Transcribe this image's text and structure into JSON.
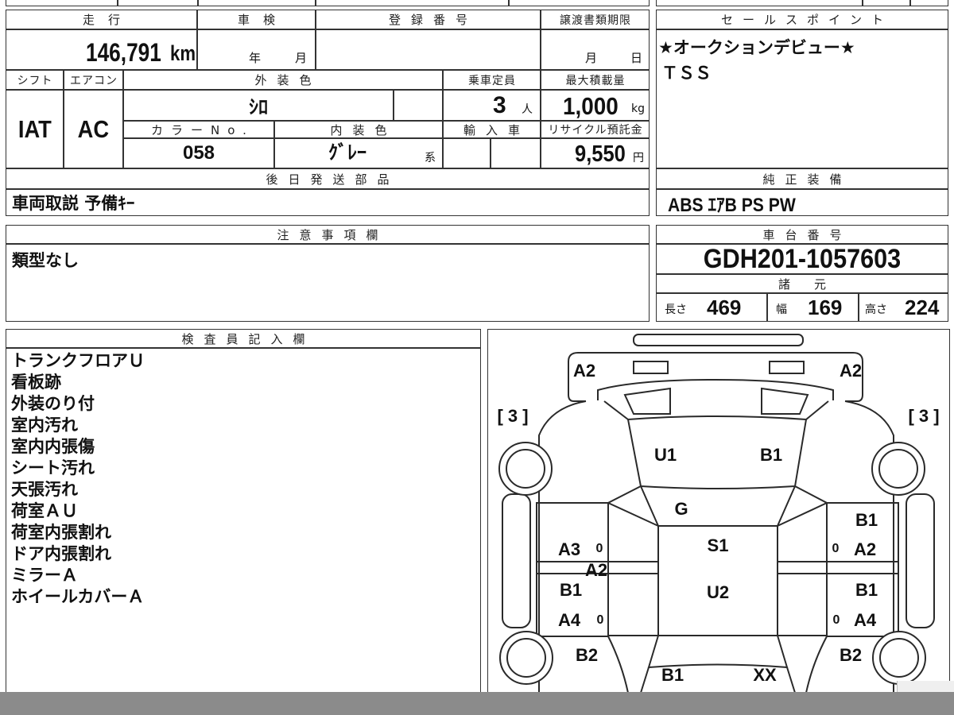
{
  "sheet": {
    "mileage": {
      "label": "走行",
      "value": "146,791",
      "unit": "km"
    },
    "inspection": {
      "label": "車検",
      "year_unit": "年",
      "month_unit": "月"
    },
    "registration": {
      "label": "登録番号"
    },
    "transfer_deadline": {
      "label": "譲渡書類期限",
      "month_unit": "月",
      "day_unit": "日"
    },
    "shift": {
      "label": "シフト",
      "value": "IAT"
    },
    "aircon": {
      "label": "エアコン",
      "value": "AC"
    },
    "exterior_color": {
      "label": "外装色",
      "value": "ｼﾛ"
    },
    "seating": {
      "label": "乗車定員",
      "value": "3",
      "unit": "人"
    },
    "max_load": {
      "label": "最大積載量",
      "value": "1,000",
      "unit": "kg"
    },
    "color_no": {
      "label": "カラーNo.",
      "value": "058"
    },
    "interior_color": {
      "label": "内装色",
      "value": "ｸﾞﾚｰ",
      "suffix": "系"
    },
    "import": {
      "label": "輸入車"
    },
    "recycle_fee": {
      "label": "リサイクル預託金",
      "value": "9,550",
      "unit": "円"
    },
    "later_parts": {
      "label": "後日発送部品",
      "value": "車両取説 予備ｷｰ"
    }
  },
  "sales_points": {
    "label": "セールスポイント",
    "lines": [
      "★オークションデビュー★",
      "ＴＳＳ"
    ]
  },
  "equipment": {
    "label": "純正装備",
    "value": "ABS ｴｱB PS PW"
  },
  "notes": {
    "label": "注意事項欄",
    "value": "類型なし"
  },
  "chassis": {
    "label": "車台番号",
    "value": "GDH201-1057603"
  },
  "specs": {
    "label": "諸元",
    "length": {
      "label": "長さ",
      "value": "469"
    },
    "width": {
      "label": "幅",
      "value": "169"
    },
    "height": {
      "label": "高さ",
      "value": "224"
    }
  },
  "inspector_notes": {
    "label": "検査員記入欄",
    "lines": [
      "トランクフロアＵ",
      "看板跡",
      "外装のり付",
      "室内汚れ",
      "室内内張傷",
      "シート汚れ",
      "天張汚れ",
      "荷室ＡＵ",
      "荷室内張割れ",
      "ドア内張割れ",
      "ミラーＡ",
      "ホイールカバーＡ"
    ]
  },
  "damage_diagram": {
    "marks": [
      "A2",
      "A2",
      "[ 3 ]",
      "[ 3 ]",
      "U1",
      "B1",
      "G",
      "S1",
      "B1",
      "A3",
      "0",
      "0",
      "A2",
      "A2",
      "B1",
      "U2",
      "B1",
      "A4",
      "0",
      "0",
      "A4",
      "B2",
      "B2",
      "B1",
      "XX"
    ]
  },
  "colors": {
    "line": "#333333",
    "footer_bar": "#8b8b8b"
  }
}
